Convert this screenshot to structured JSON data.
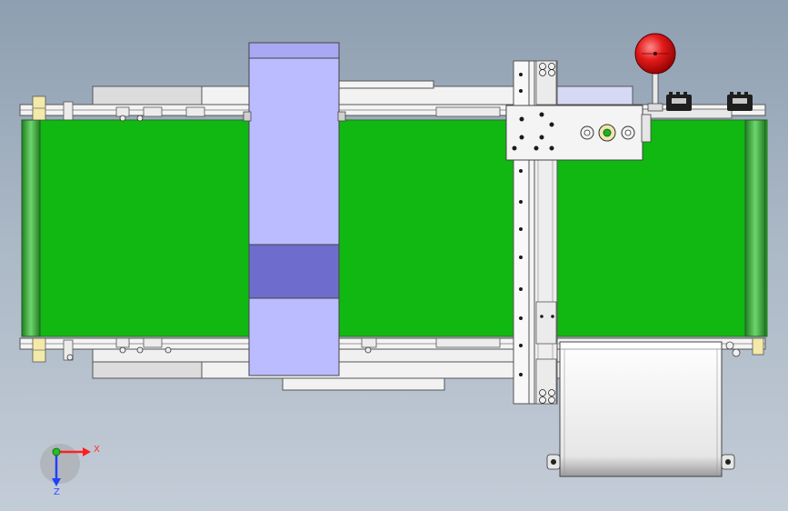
{
  "viewport": {
    "background_top": "#8e9fb1",
    "background_bottom": "#c3ccd7"
  },
  "model": {
    "belt_color": "#11b811",
    "roller_color": "#2f9f2f",
    "tunnel_color": "#bbbcff",
    "tunnel_window_color": "#6e6ccc",
    "frame_color": "#f4f4f4",
    "knob_color": "#e31b1b"
  },
  "triad": {
    "x_label": "X",
    "z_label": "Z",
    "x_color": "#ff2020",
    "y_color": "#20c020",
    "z_color": "#2040ff"
  }
}
